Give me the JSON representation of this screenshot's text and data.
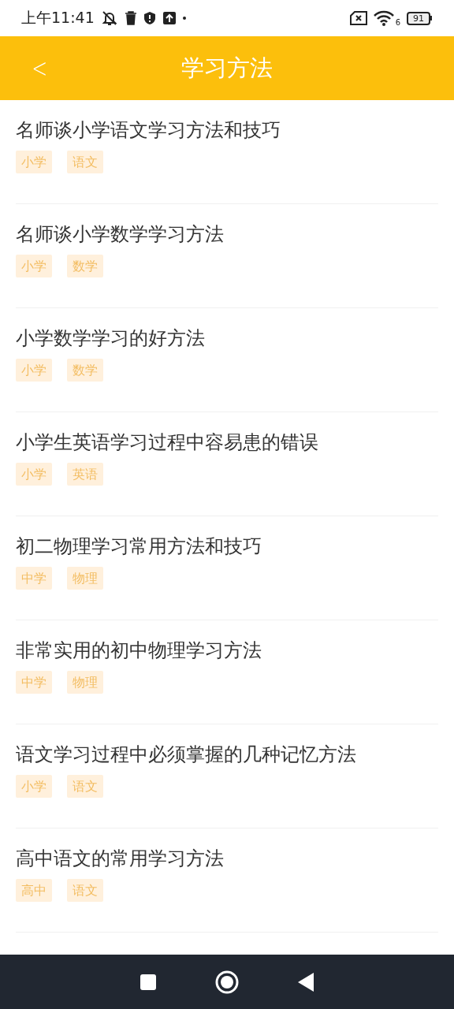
{
  "status_bar": {
    "time": "上午11:41",
    "wifi_label": "6",
    "battery": "91"
  },
  "header": {
    "back": "<",
    "title": "学习方法"
  },
  "articles": [
    {
      "title": "名师谈小学语文学习方法和技巧",
      "tags": [
        "小学",
        "语文"
      ]
    },
    {
      "title": "名师谈小学数学学习方法",
      "tags": [
        "小学",
        "数学"
      ]
    },
    {
      "title": "小学数学学习的好方法",
      "tags": [
        "小学",
        "数学"
      ]
    },
    {
      "title": "小学生英语学习过程中容易患的错误",
      "tags": [
        "小学",
        "英语"
      ]
    },
    {
      "title": "初二物理学习常用方法和技巧",
      "tags": [
        "中学",
        "物理"
      ]
    },
    {
      "title": "非常实用的初中物理学习方法",
      "tags": [
        "中学",
        "物理"
      ]
    },
    {
      "title": "语文学习过程中必须掌握的几种记忆方法",
      "tags": [
        "小学",
        "语文"
      ]
    },
    {
      "title": "高中语文的常用学习方法",
      "tags": [
        "高中",
        "语文"
      ]
    }
  ]
}
